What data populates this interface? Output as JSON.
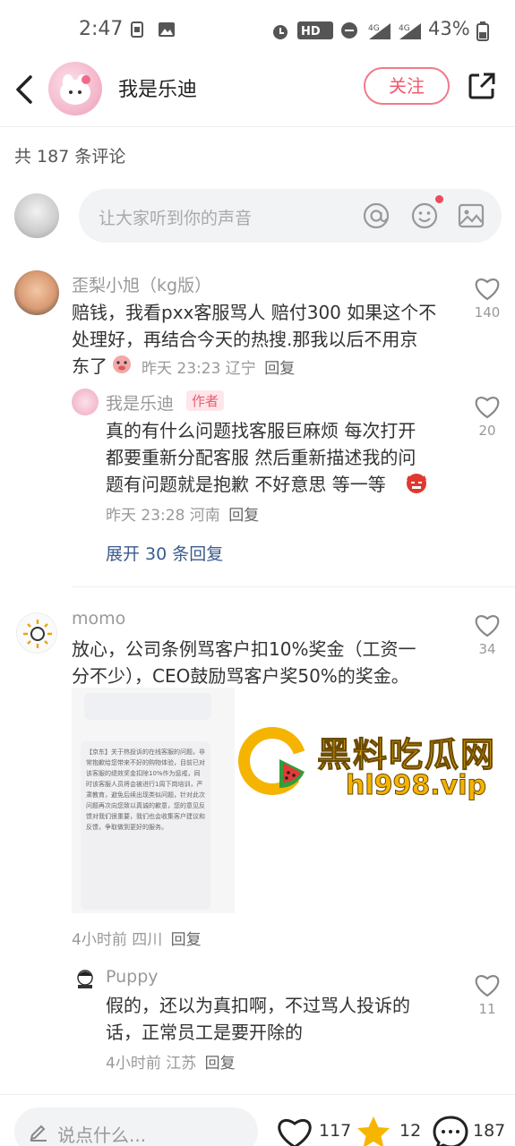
{
  "status_bar": {
    "time": "2:47",
    "battery": "43%"
  },
  "header": {
    "title": "我是乐迪",
    "follow_label": "关注"
  },
  "comment_count_label": "共 187 条评论",
  "input": {
    "placeholder": "让大家听到你的声音"
  },
  "comments": [
    {
      "name": "歪梨小旭（kg版）",
      "lines": [
        "赔钱，我看pxx客服骂人 赔付300 如果这个不",
        "处理好，再结合今天的热搜.那我以后不用京",
        "东了"
      ],
      "meta": "昨天 23:23 辽宁",
      "reply": "回复",
      "likes": "140",
      "replies": [
        {
          "name": "我是乐迪",
          "tag": "作者",
          "lines": [
            "真的有什么问题找客服巨麻烦 每次打开",
            "都要重新分配客服 然后重新描述我的问",
            "题有问题就是抱歉 不好意思 等一等"
          ],
          "meta": "昨天 23:28 河南",
          "reply": "回复",
          "likes": "20"
        }
      ],
      "expand": "展开 30 条回复"
    },
    {
      "name": "momo",
      "lines": [
        "放心，公司条例骂客户扣10%奖金（工资一",
        "分不少），CEO鼓励骂客户奖50%的奖金。"
      ],
      "meta": "4小时前 四川",
      "reply": "回复",
      "likes": "34",
      "replies": [
        {
          "name": "Puppy",
          "lines": [
            "假的，还以为真扣啊，不过骂人投诉的",
            "话，正常员工是要开除的"
          ],
          "meta": "4小时前 江苏",
          "reply": "回复",
          "likes": "11"
        }
      ]
    }
  ],
  "image_text": {
    "header": "【京东】关于热投诉的在线客服的问题，非常抱歉给您带来不好的购物体验，目前已对该客服的绩效奖金扣除10%作为惩戒，同时该客服人员将会被进行1周下岗培训，严肃教育，避免后续出现类似问题，针对此次问题再次向您致以真诚的歉意，您的意见反馈对我们很重要，我们也会收集客户建议和反馈，争取做到更好的服务。"
  },
  "watermark": {
    "title": "黑料吃瓜网",
    "url": "hl998.vip"
  },
  "bottom_bar": {
    "placeholder": "说点什么...",
    "likes": "117",
    "stars": "12",
    "comments": "187"
  },
  "colors": {
    "accent": "#f05a6e",
    "link": "#3b5b8c",
    "watermark": "#f5b400"
  }
}
